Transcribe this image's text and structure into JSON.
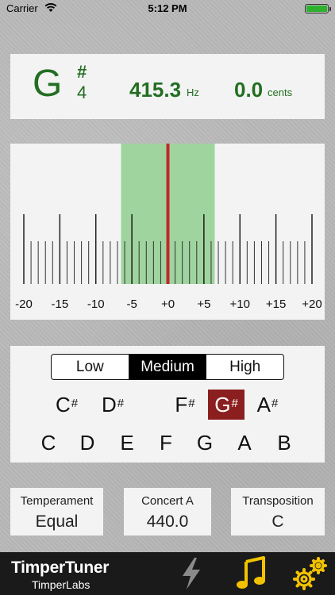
{
  "status_bar": {
    "carrier": "Carrier",
    "time": "5:12 PM"
  },
  "reading": {
    "note": "G",
    "accidental": "#",
    "octave": "4",
    "frequency": "415.3",
    "frequency_unit": "Hz",
    "cents": "0.0",
    "cents_unit": "cents"
  },
  "meter": {
    "scale_labels": [
      "-20",
      "-15",
      "-10",
      "-5",
      "+0",
      "+5",
      "+10",
      "+15",
      "+20"
    ],
    "needle_cents": 0,
    "in_tune_range_cents": [
      -6.5,
      6.5
    ],
    "colors": {
      "zone": "#9fd49f",
      "needle": "#c1272d"
    }
  },
  "range_selector": {
    "options": [
      "Low",
      "Medium",
      "High"
    ],
    "selected": "Medium"
  },
  "note_keys": {
    "sharps": [
      "C",
      "D",
      "F",
      "G",
      "A"
    ],
    "naturals": [
      "C",
      "D",
      "E",
      "F",
      "G",
      "A",
      "B"
    ],
    "sharp_symbol": "#",
    "selected": "G#",
    "selected_color": "#8b1f1f"
  },
  "settings": [
    {
      "label": "Temperament",
      "value": "Equal"
    },
    {
      "label": "Concert A",
      "value": "440.0"
    },
    {
      "label": "Transposition",
      "value": "C"
    }
  ],
  "bottom_bar": {
    "app_name": "TimperTuner",
    "developer": "TimperLabs",
    "icons": [
      "lightning-icon",
      "music-note-icon",
      "gears-icon"
    ],
    "colors": {
      "lightning": "#8a8a8a",
      "accent": "#f2c200"
    }
  },
  "theme": {
    "reading_green": "#226e22",
    "battery": "#2fb12f"
  }
}
